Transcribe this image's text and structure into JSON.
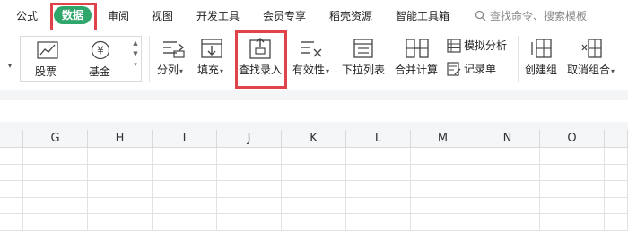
{
  "tabs": [
    {
      "id": "formula",
      "label": "公式"
    },
    {
      "id": "data",
      "label": "数据",
      "active": true
    },
    {
      "id": "review",
      "label": "审阅"
    },
    {
      "id": "view",
      "label": "视图"
    },
    {
      "id": "dev",
      "label": "开发工具"
    },
    {
      "id": "member",
      "label": "会员专享"
    },
    {
      "id": "docer",
      "label": "稻壳资源"
    },
    {
      "id": "smart",
      "label": "智能工具箱"
    }
  ],
  "search": {
    "placeholder": "查找命令、搜索模板"
  },
  "gallery": {
    "stock_label": "股票",
    "fund_label": "基金"
  },
  "ribbon": {
    "split": "分列",
    "fill": "填充",
    "lookup_entry": "查找录入",
    "validity": "有效性",
    "dropdown_list": "下拉列表",
    "merge_calc": "合并计算",
    "simulate": "模拟分析",
    "record": "记录单",
    "group": "创建组",
    "ungroup": "取消组合"
  },
  "columns": [
    "G",
    "H",
    "I",
    "J",
    "K",
    "L",
    "M",
    "N",
    "O"
  ],
  "colors": {
    "accent": "#2fa66a",
    "highlight": "#e0444a"
  }
}
